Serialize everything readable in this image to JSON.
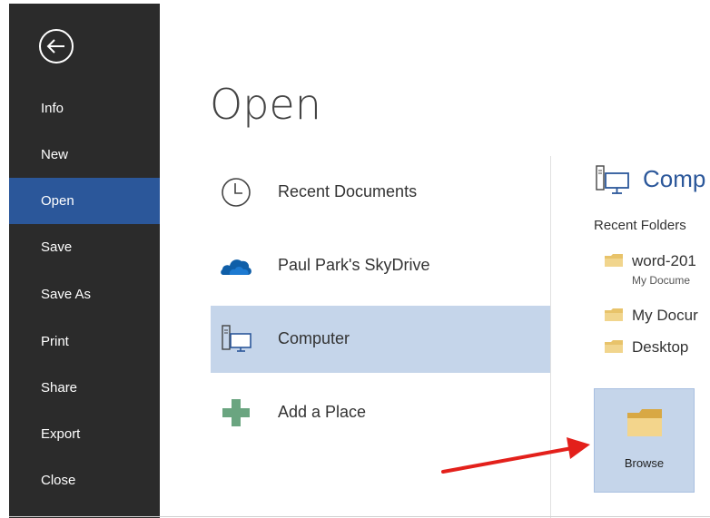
{
  "sidebar": {
    "back_icon": "back-arrow-icon",
    "items": [
      {
        "label": "Info",
        "active": false
      },
      {
        "label": "New",
        "active": false
      },
      {
        "label": "Open",
        "active": true
      },
      {
        "label": "Save",
        "active": false
      },
      {
        "label": "Save As",
        "active": false
      },
      {
        "label": "Print",
        "active": false
      },
      {
        "label": "Share",
        "active": false
      },
      {
        "label": "Export",
        "active": false
      },
      {
        "label": "Close",
        "active": false
      }
    ]
  },
  "page": {
    "title": "Open"
  },
  "places": [
    {
      "label": "Recent Documents",
      "icon": "clock-icon",
      "selected": false
    },
    {
      "label": "Paul Park's SkyDrive",
      "icon": "cloud-icon",
      "selected": false
    },
    {
      "label": "Computer",
      "icon": "computer-icon",
      "selected": true
    },
    {
      "label": "Add a Place",
      "icon": "plus-icon",
      "selected": false
    }
  ],
  "panel": {
    "title": "Comp",
    "recent_label": "Recent Folders",
    "folders": [
      {
        "name": "word-201",
        "path": "My Docume"
      },
      {
        "name": "My Docur",
        "path": ""
      },
      {
        "name": "Desktop",
        "path": ""
      }
    ],
    "browse_label": "Browse"
  },
  "colors": {
    "sidebar_bg": "#2b2b2b",
    "active_nav": "#2b579a",
    "selected_place": "#c5d5ea",
    "accent_text": "#2b579a",
    "annotation_arrow": "#e3201b"
  }
}
